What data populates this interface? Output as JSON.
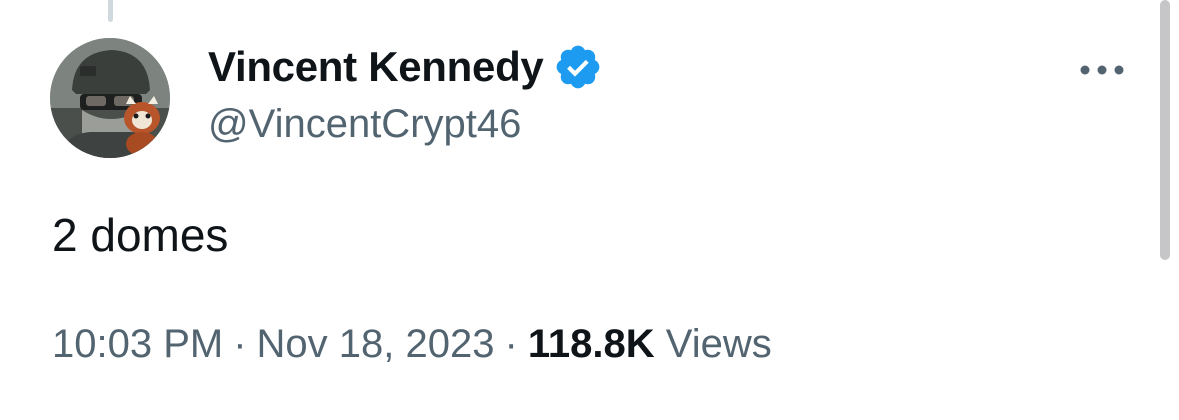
{
  "author": {
    "display_name": "Vincent Kennedy",
    "handle": "@VincentCrypt46",
    "verified": true,
    "verified_badge_color": "#1d9bf0",
    "avatar_icon": "avatar-soldier-with-red-panda"
  },
  "tweet": {
    "text": "2 domes"
  },
  "meta": {
    "time": "10:03 PM",
    "separator": "·",
    "date": "Nov 18, 2023",
    "views_count": "118.8K",
    "views_label": "Views"
  },
  "actions": {
    "more_icon": "more-horizontal-icon"
  },
  "colors": {
    "text_primary": "#0f1419",
    "text_secondary": "#536471",
    "thread_line": "#cfd9de"
  }
}
